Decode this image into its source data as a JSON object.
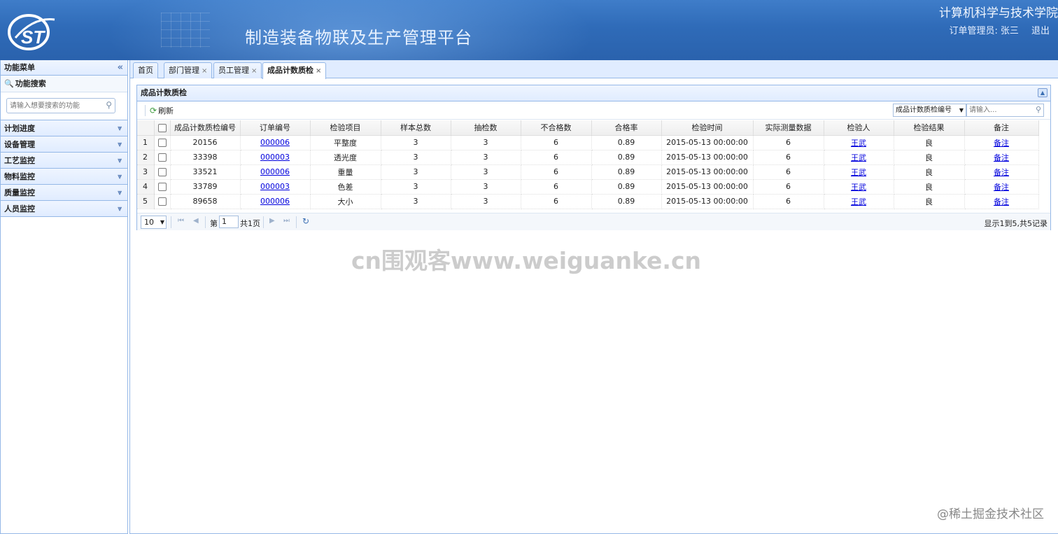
{
  "header": {
    "app_title": "制造装备物联及生产管理平台",
    "college": "计算机科学与技术学院",
    "user_label": "订单管理员:",
    "user_name": "张三",
    "logout": "退出"
  },
  "sidebar": {
    "title": "功能菜单",
    "search_title": "功能搜索",
    "search_placeholder": "请输入想要搜索的功能",
    "items": [
      {
        "label": "计划进度"
      },
      {
        "label": "设备管理"
      },
      {
        "label": "工艺监控"
      },
      {
        "label": "物料监控"
      },
      {
        "label": "质量监控"
      },
      {
        "label": "人员监控"
      }
    ]
  },
  "tabs": [
    {
      "label": "首页",
      "closable": false
    },
    {
      "label": "部门管理",
      "closable": true
    },
    {
      "label": "员工管理",
      "closable": true
    },
    {
      "label": "成品计数质检",
      "closable": true,
      "active": true
    }
  ],
  "panel": {
    "title": "成品计数质检",
    "refresh_label": "刷新",
    "search_field": "成品计数质检编号",
    "search_placeholder": "请输入..."
  },
  "grid": {
    "columns": [
      "成品计数质检编号",
      "订单编号",
      "检验项目",
      "样本总数",
      "抽检数",
      "不合格数",
      "合格率",
      "检验时间",
      "实际测量数据",
      "检验人",
      "检验结果",
      "备注"
    ],
    "rows": [
      {
        "num": "1",
        "id": "20156",
        "order": "000006",
        "item": "平整度",
        "total": "3",
        "sample": "3",
        "fail": "6",
        "rate": "0.89",
        "time": "2015-05-13 00:00:00",
        "measure": "6",
        "inspector": "王武",
        "result": "良",
        "note": "备注"
      },
      {
        "num": "2",
        "id": "33398",
        "order": "000003",
        "item": "透光度",
        "total": "3",
        "sample": "3",
        "fail": "6",
        "rate": "0.89",
        "time": "2015-05-13 00:00:00",
        "measure": "6",
        "inspector": "王武",
        "result": "良",
        "note": "备注"
      },
      {
        "num": "3",
        "id": "33521",
        "order": "000006",
        "item": "重量",
        "total": "3",
        "sample": "3",
        "fail": "6",
        "rate": "0.89",
        "time": "2015-05-13 00:00:00",
        "measure": "6",
        "inspector": "王武",
        "result": "良",
        "note": "备注"
      },
      {
        "num": "4",
        "id": "33789",
        "order": "000003",
        "item": "色差",
        "total": "3",
        "sample": "3",
        "fail": "6",
        "rate": "0.89",
        "time": "2015-05-13 00:00:00",
        "measure": "6",
        "inspector": "王武",
        "result": "良",
        "note": "备注"
      },
      {
        "num": "5",
        "id": "89658",
        "order": "000006",
        "item": "大小",
        "total": "3",
        "sample": "3",
        "fail": "6",
        "rate": "0.89",
        "time": "2015-05-13 00:00:00",
        "measure": "6",
        "inspector": "王武",
        "result": "良",
        "note": "备注"
      }
    ]
  },
  "pager": {
    "page_size": "10",
    "page_prefix": "第",
    "page_value": "1",
    "page_total": "共1页",
    "info": "显示1到5,共5记录"
  },
  "watermark": "cn围观客www.weiguanke.cn",
  "credit": "@稀土掘金技术社区",
  "colors": {
    "header": "#2f6bb8",
    "border": "#95b8e7",
    "link": "#0000dd"
  }
}
